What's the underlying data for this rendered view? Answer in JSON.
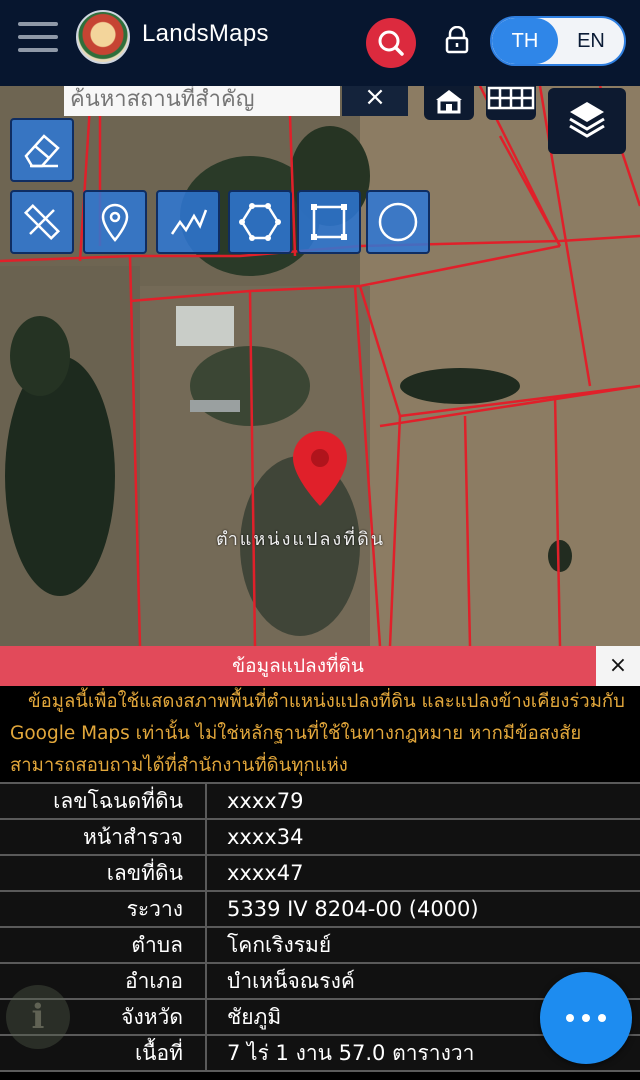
{
  "header": {
    "brand": "LandsMaps",
    "menu_icon": "hamburger-menu-icon",
    "search_icon": "search-icon",
    "lock_icon": "lock-icon",
    "lang_th": "TH",
    "lang_en": "EN",
    "lang_selected": "TH"
  },
  "map": {
    "search_placeholder": "ค้นหาสถานที่สำคัญ",
    "search_clear": "×",
    "pin_label": "ตำแหน่งแปลงที่ดิน",
    "tools": [
      "eraser-icon",
      "ruler-icon",
      "location-pin-icon",
      "polyline-icon",
      "polygon-icon",
      "rectangle-icon",
      "circle-icon"
    ],
    "controls": [
      "home-icon",
      "grid-icon",
      "layers-icon"
    ]
  },
  "panel": {
    "title": "ข้อมูลแปลงที่ดิน",
    "close": "×",
    "notice": "ข้อมูลนี้เพื่อใช้แสดงสภาพพื้นที่ตำแหน่งแปลงที่ดิน และแปลงข้างเคียงร่วมกับ Google Maps เท่านั้น ไม่ใช่หลักฐานที่ใช้ในทางกฎหมาย หากมีข้อสงสัยสามารถสอบถามได้ที่สำนักงานที่ดินทุกแห่ง",
    "rows": [
      {
        "label": "เลขโฉนดที่ดิน",
        "value": "xxxx79"
      },
      {
        "label": "หน้าสำรวจ",
        "value": "xxxx34"
      },
      {
        "label": "เลขที่ดิน",
        "value": "xxxx47"
      },
      {
        "label": "ระวาง",
        "value": "5339 IV 8204-00 (4000)"
      },
      {
        "label": "ตำบล",
        "value": "โคกเริงรมย์"
      },
      {
        "label": "อำเภอ",
        "value": "บำเหน็จณรงค์"
      },
      {
        "label": "จังหวัด",
        "value": "ชัยภูมิ"
      },
      {
        "label": "เนื้อที่",
        "value": "7 ไร่ 1 งาน 57.0 ตารางวา"
      }
    ]
  },
  "fabs": {
    "info_icon": "info-icon",
    "info_glyph": "i",
    "more_icon": "more-dots-icon"
  },
  "colors": {
    "topbar": "#07162f",
    "accent_red": "#dc2a3e",
    "accent_blue": "#2f86e8",
    "panel_header": "#e24a5a",
    "notice_text": "#e2a73b",
    "parcel_lines": "#e0202a"
  }
}
